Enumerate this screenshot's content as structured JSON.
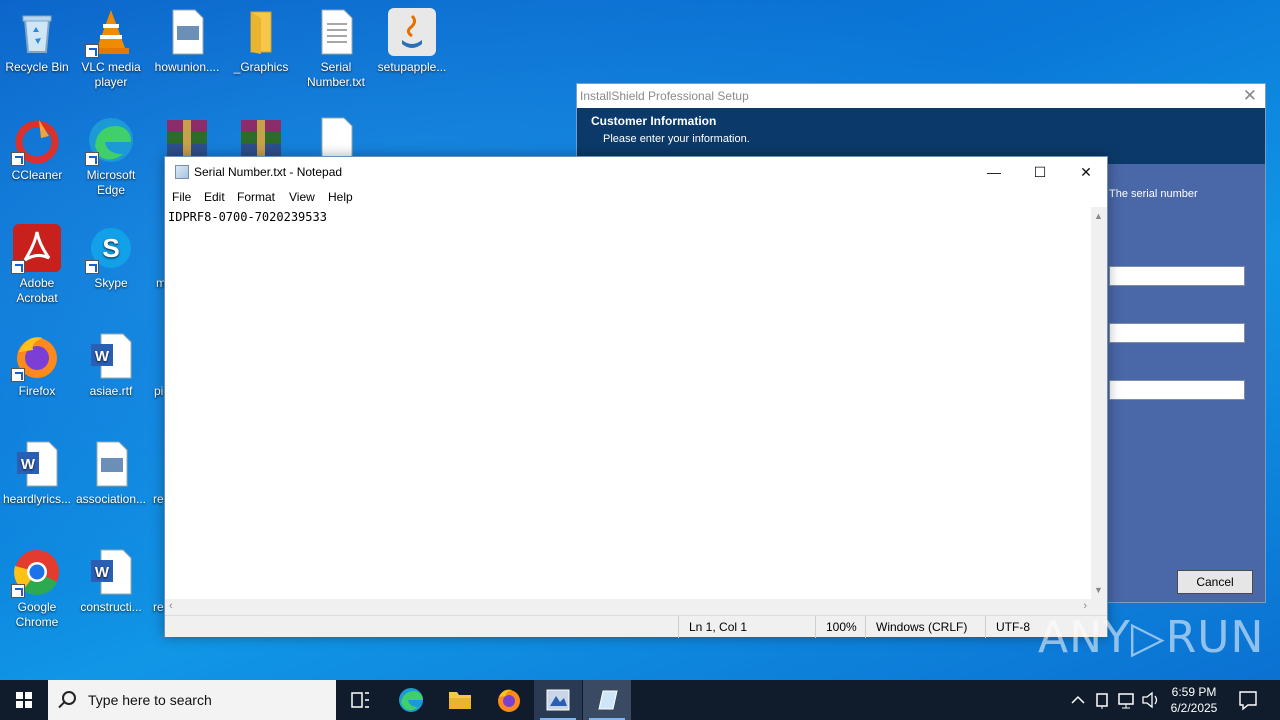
{
  "desktop": {
    "icons": [
      {
        "name": "recycle-bin",
        "label": "Recycle Bin"
      },
      {
        "name": "vlc",
        "label": "VLC media player"
      },
      {
        "name": "howunion",
        "label": "howunion...."
      },
      {
        "name": "graphics-folder",
        "label": "_Graphics"
      },
      {
        "name": "serial-number-file",
        "label": "Serial Number.txt"
      },
      {
        "name": "setupapple",
        "label": "setupapple..."
      },
      {
        "name": "ccleaner",
        "label": "CCleaner"
      },
      {
        "name": "edge",
        "label": "Microsoft Edge"
      },
      {
        "name": "adobe-acrobat",
        "label": "Adobe Acrobat"
      },
      {
        "name": "skype",
        "label": "Skype"
      },
      {
        "name": "firefox",
        "label": "Firefox"
      },
      {
        "name": "asiae",
        "label": "asiae.rtf"
      },
      {
        "name": "heardlyrics",
        "label": "heardlyrics..."
      },
      {
        "name": "association",
        "label": "association..."
      },
      {
        "name": "chrome",
        "label": "Google Chrome"
      },
      {
        "name": "constructi",
        "label": "constructi..."
      }
    ],
    "partial_labels": {
      "m": "m",
      "pi": "pi",
      "re1": "re",
      "re2": "re"
    }
  },
  "installshield": {
    "title": "InstallShield Professional Setup",
    "header_title": "Customer Information",
    "header_subtitle": "Please enter your information.",
    "body_text": "The serial number",
    "cancel_label": "Cancel"
  },
  "notepad": {
    "title": "Serial Number.txt - Notepad",
    "menu": {
      "file": "File",
      "edit": "Edit",
      "format": "Format",
      "view": "View",
      "help": "Help"
    },
    "content": "IDPRF8-0700-7020239533",
    "status": {
      "position": "Ln 1, Col 1",
      "zoom": "100%",
      "line_ending": "Windows (CRLF)",
      "encoding": "UTF-8"
    }
  },
  "watermark": "ANY▷RUN",
  "taskbar": {
    "search_placeholder": "Type here to search",
    "time": "6:59 PM",
    "date": "6/2/2025"
  },
  "colors": {
    "desktop": "#0a78d8",
    "taskbar": "#101b2b",
    "installshield_header": "#0b3a6a",
    "installshield_body": "#4a67a8"
  }
}
